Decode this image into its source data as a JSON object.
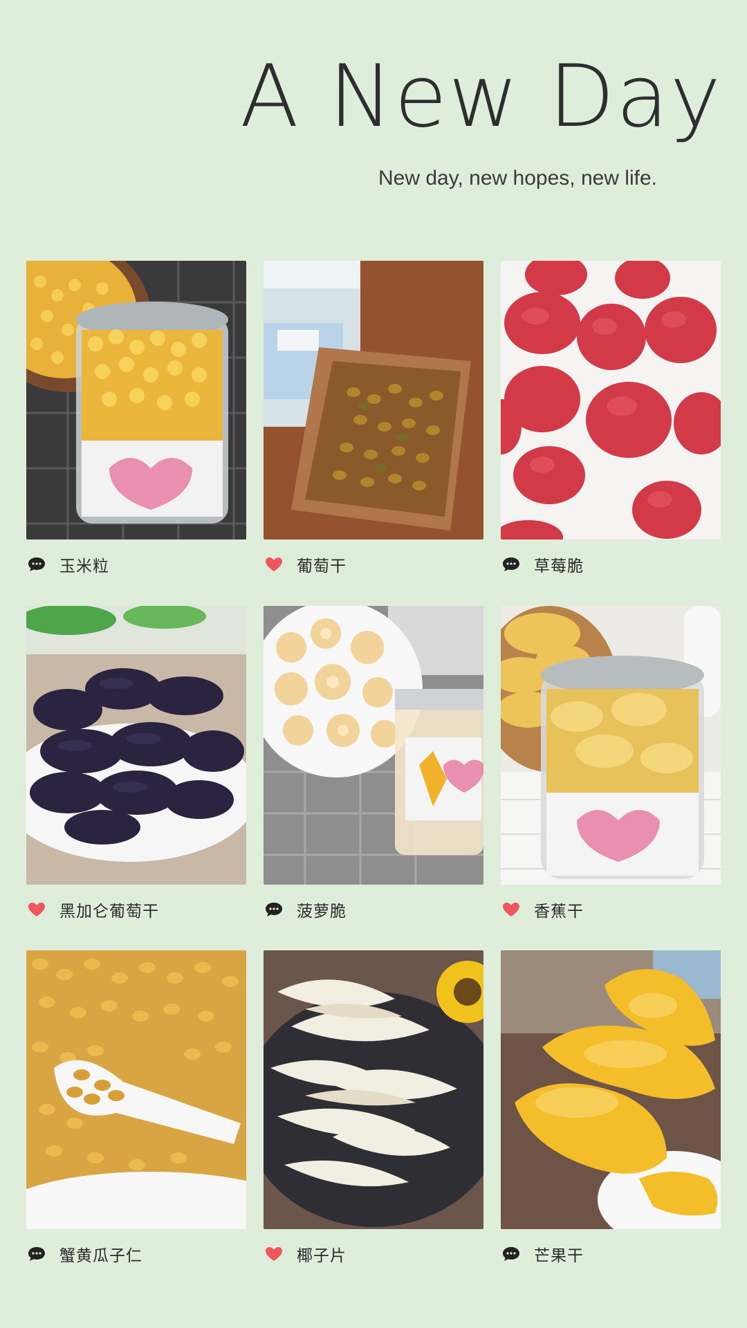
{
  "header": {
    "title": "A New Day",
    "subtitle": "New day, new hopes, new life."
  },
  "colors": {
    "background": "#dfeedb",
    "heart": "#f0575c",
    "comment": "#222222"
  },
  "items": [
    {
      "label": "玉米粒",
      "icon": "comment-icon",
      "photo": "corn-jar"
    },
    {
      "label": "葡萄干",
      "icon": "heart-icon",
      "photo": "raisins-tray"
    },
    {
      "label": "草莓脆",
      "icon": "comment-icon",
      "photo": "freeze-dried-strawberries"
    },
    {
      "label": "黑加仑葡萄干",
      "icon": "heart-icon",
      "photo": "black-currant-raisins"
    },
    {
      "label": "菠萝脆",
      "icon": "comment-icon",
      "photo": "pineapple-chips"
    },
    {
      "label": "香蕉干",
      "icon": "heart-icon",
      "photo": "banana-chips-jar"
    },
    {
      "label": "蟹黄瓜子仁",
      "icon": "comment-icon",
      "photo": "seasoned-sunflower-seeds"
    },
    {
      "label": "椰子片",
      "icon": "heart-icon",
      "photo": "coconut-chips"
    },
    {
      "label": "芒果干",
      "icon": "comment-icon",
      "photo": "dried-mango"
    }
  ]
}
